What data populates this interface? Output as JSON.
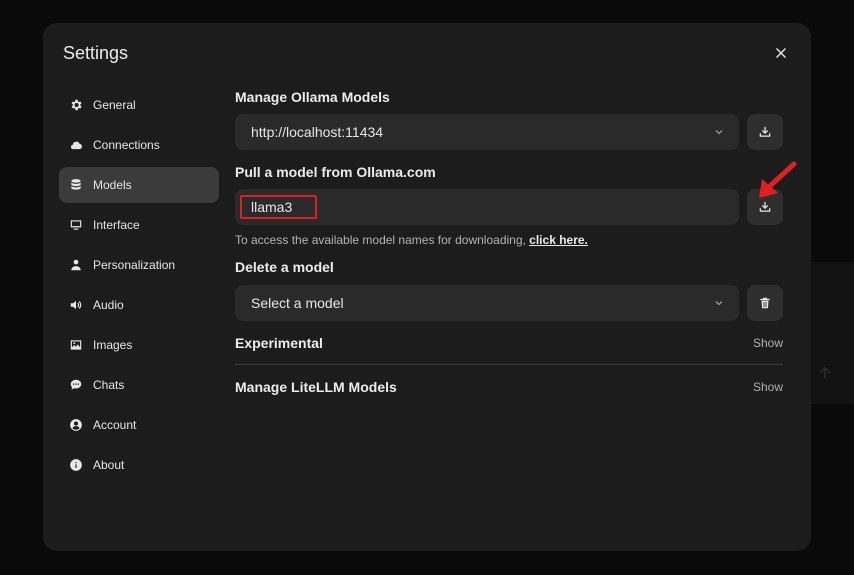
{
  "modal": {
    "title": "Settings"
  },
  "sidebar": {
    "items": [
      {
        "label": "General",
        "icon": "gear-icon"
      },
      {
        "label": "Connections",
        "icon": "cloud-icon"
      },
      {
        "label": "Models",
        "icon": "database-icon",
        "active": true
      },
      {
        "label": "Interface",
        "icon": "monitor-icon"
      },
      {
        "label": "Personalization",
        "icon": "user-icon"
      },
      {
        "label": "Audio",
        "icon": "speaker-icon"
      },
      {
        "label": "Images",
        "icon": "image-icon"
      },
      {
        "label": "Chats",
        "icon": "chat-bubble-icon"
      },
      {
        "label": "Account",
        "icon": "user-circle-icon"
      },
      {
        "label": "About",
        "icon": "info-icon"
      }
    ]
  },
  "manage": {
    "title": "Manage Ollama Models",
    "selected_url": "http://localhost:11434"
  },
  "pull": {
    "title": "Pull a model from Ollama.com",
    "input_value": "llama3",
    "hint_text": "To access the available model names for downloading, ",
    "hint_link": "click here."
  },
  "delete": {
    "title": "Delete a model",
    "placeholder": "Select a model"
  },
  "experimental": {
    "title": "Experimental",
    "toggle": "Show"
  },
  "litellm": {
    "title": "Manage LiteLLM Models",
    "toggle": "Show"
  },
  "colors": {
    "modal_bg": "#1c1c1c",
    "active_item": "#3b3b3b",
    "annotation": "#e02020"
  }
}
